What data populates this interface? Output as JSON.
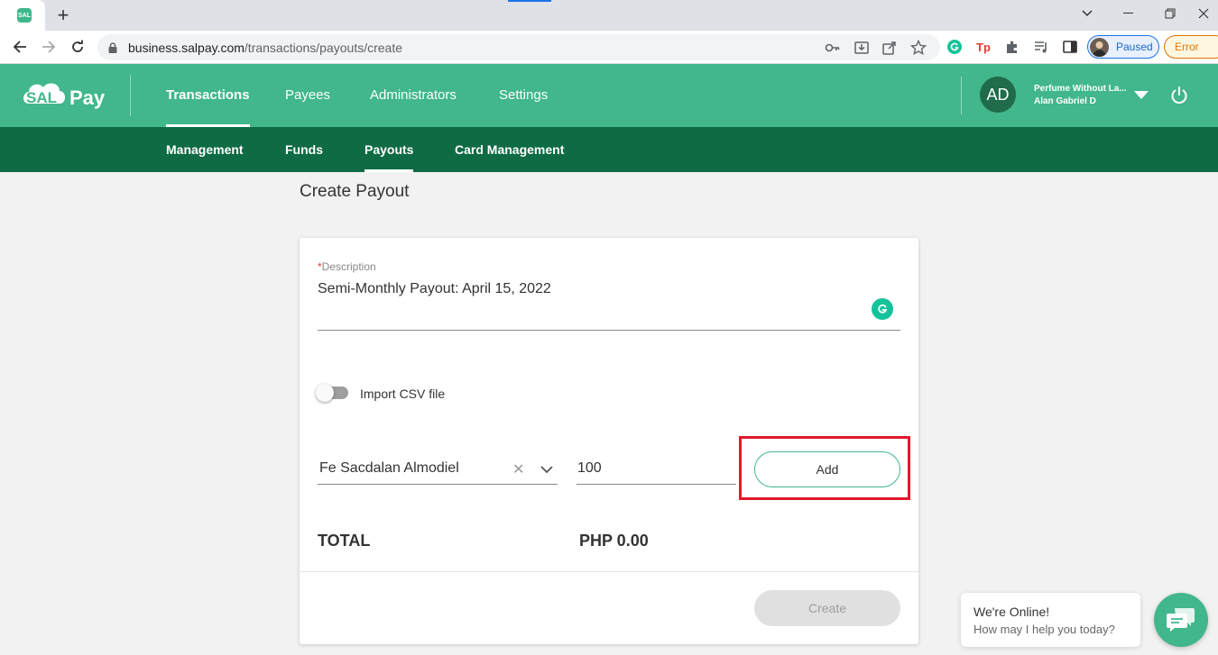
{
  "browser": {
    "url_host": "business.salpay.com",
    "url_path": "/transactions/payouts/create",
    "profile_status": "Paused",
    "error_label": "Error",
    "favicon_text": "SAL"
  },
  "header": {
    "logo_left": "SAL",
    "logo_right": "Pay",
    "nav": [
      "Transactions",
      "Payees",
      "Administrators",
      "Settings"
    ],
    "active_nav": "Transactions",
    "avatar_initials": "AD",
    "business_name": "Perfume Without La...",
    "user_name": "Alan Gabriel D"
  },
  "subnav": {
    "items": [
      "Management",
      "Funds",
      "Payouts",
      "Card Management"
    ],
    "active": "Payouts"
  },
  "page": {
    "title": "Create Payout",
    "description_label": "Description",
    "description_required_mark": "*",
    "description_value": "Semi-Monthly Payout: April 15, 2022",
    "import_csv_label": "Import CSV file",
    "import_csv_on": false,
    "payee_value": "Fe Sacdalan Almodiel",
    "amount_value": "100",
    "add_label": "Add",
    "total_label": "TOTAL",
    "total_value": "PHP 0.00",
    "create_label": "Create"
  },
  "chat": {
    "title": "We're Online!",
    "subtitle": "How may I help you today?"
  },
  "colors": {
    "brand_green": "#41b78b",
    "dark_green": "#0e6b43",
    "highlight_red": "#e0192d"
  },
  "icons": {
    "back": "arrow-left-icon",
    "forward": "arrow-right-icon",
    "reload": "reload-icon",
    "lock": "lock-icon",
    "chat": "chat-icon",
    "power": "power-icon"
  }
}
